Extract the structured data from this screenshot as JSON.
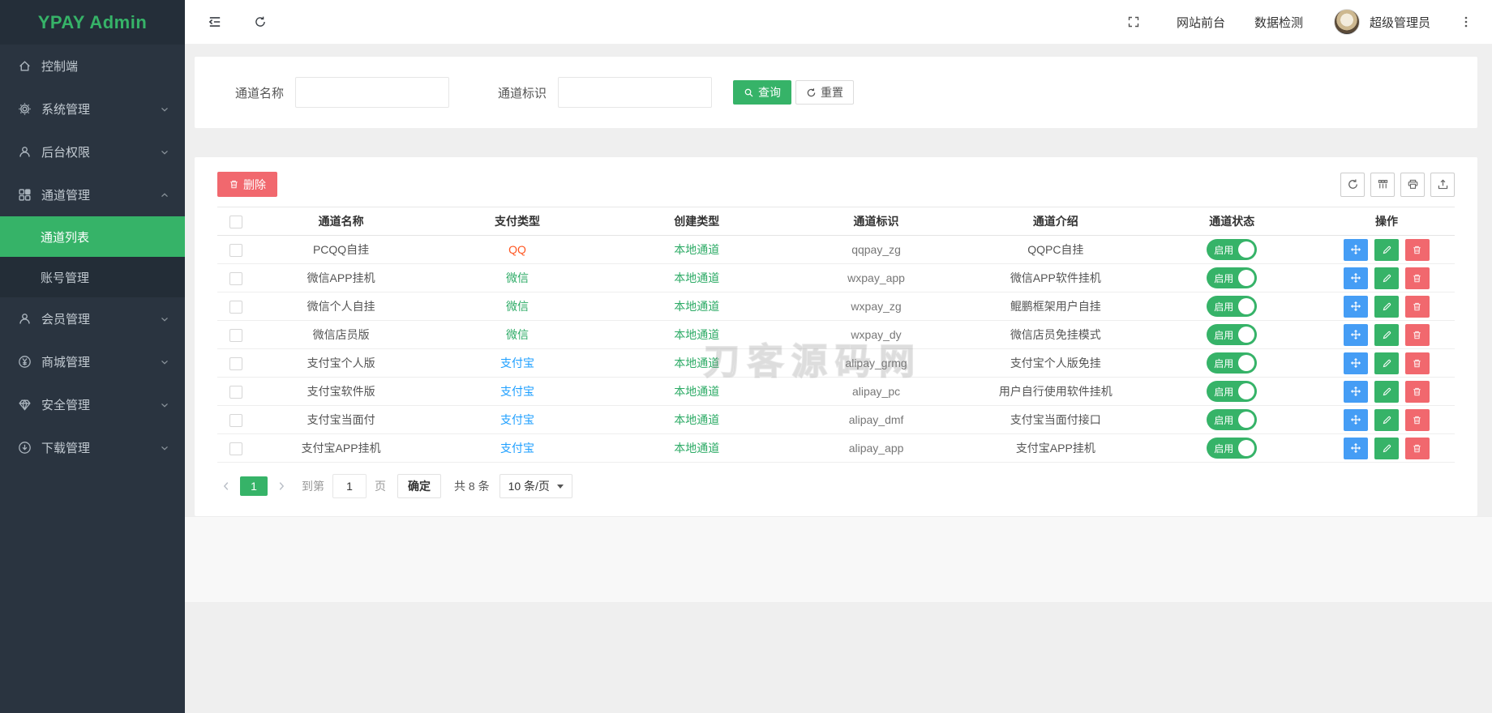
{
  "app": {
    "title": "YPAY Admin"
  },
  "colors": {
    "green": "#36b368",
    "blue": "#459df5",
    "red": "#f1686e",
    "qq_red": "#ff5722",
    "link_blue": "#1e9fff",
    "text_green": "#2dab66",
    "sidebar_bg": "#2a3440"
  },
  "sidebar": {
    "logo": "YPAY Admin",
    "items": [
      {
        "label": "控制端",
        "icon": "home-icon"
      },
      {
        "label": "系统管理",
        "icon": "gear-icon"
      },
      {
        "label": "后台权限",
        "icon": "user-icon"
      },
      {
        "label": "通道管理",
        "icon": "blocks-icon",
        "expanded": true,
        "children": [
          {
            "label": "通道列表",
            "active": true
          },
          {
            "label": "账号管理",
            "active": false
          }
        ]
      },
      {
        "label": "会员管理",
        "icon": "user-icon"
      },
      {
        "label": "商城管理",
        "icon": "yen-circle-icon"
      },
      {
        "label": "安全管理",
        "icon": "gem-icon"
      },
      {
        "label": "下载管理",
        "icon": "download-circle-icon"
      }
    ]
  },
  "topbar": {
    "links": [
      "网站前台",
      "数据检测"
    ],
    "username": "超级管理员",
    "icons": [
      "menu-fold-icon",
      "refresh-icon",
      "fullscreen-icon",
      "more-vertical-icon"
    ]
  },
  "filter": {
    "fields": [
      {
        "label": "通道名称",
        "value": ""
      },
      {
        "label": "通道标识",
        "value": ""
      }
    ],
    "search_label": "查询",
    "reset_label": "重置"
  },
  "table": {
    "delete_label": "删除",
    "toolbar_icons": [
      "refresh-icon",
      "columns-icon",
      "print-icon",
      "export-icon"
    ],
    "columns": [
      "通道名称",
      "支付类型",
      "创建类型",
      "通道标识",
      "通道介绍",
      "通道状态",
      "操作"
    ],
    "rows": [
      {
        "name": "PCQQ自挂",
        "pay_type": "QQ",
        "pay_type_color": "#ff5722",
        "create_type": "本地通道",
        "create_type_color": "#2dab66",
        "code": "qqpay_zg",
        "desc": "QQPC自挂",
        "status": "启用"
      },
      {
        "name": "微信APP挂机",
        "pay_type": "微信",
        "pay_type_color": "#2dab66",
        "create_type": "本地通道",
        "create_type_color": "#2dab66",
        "code": "wxpay_app",
        "desc": "微信APP软件挂机",
        "status": "启用"
      },
      {
        "name": "微信个人自挂",
        "pay_type": "微信",
        "pay_type_color": "#2dab66",
        "create_type": "本地通道",
        "create_type_color": "#2dab66",
        "code": "wxpay_zg",
        "desc": "鲲鹏框架用户自挂",
        "status": "启用"
      },
      {
        "name": "微信店员版",
        "pay_type": "微信",
        "pay_type_color": "#2dab66",
        "create_type": "本地通道",
        "create_type_color": "#2dab66",
        "code": "wxpay_dy",
        "desc": "微信店员免挂模式",
        "status": "启用"
      },
      {
        "name": "支付宝个人版",
        "pay_type": "支付宝",
        "pay_type_color": "#1e9fff",
        "create_type": "本地通道",
        "create_type_color": "#2dab66",
        "code": "alipay_grmg",
        "desc": "支付宝个人版免挂",
        "status": "启用"
      },
      {
        "name": "支付宝软件版",
        "pay_type": "支付宝",
        "pay_type_color": "#1e9fff",
        "create_type": "本地通道",
        "create_type_color": "#2dab66",
        "code": "alipay_pc",
        "desc": "用户自行使用软件挂机",
        "status": "启用"
      },
      {
        "name": "支付宝当面付",
        "pay_type": "支付宝",
        "pay_type_color": "#1e9fff",
        "create_type": "本地通道",
        "create_type_color": "#2dab66",
        "code": "alipay_dmf",
        "desc": "支付宝当面付接口",
        "status": "启用"
      },
      {
        "name": "支付宝APP挂机",
        "pay_type": "支付宝",
        "pay_type_color": "#1e9fff",
        "create_type": "本地通道",
        "create_type_color": "#2dab66",
        "code": "alipay_app",
        "desc": "支付宝APP挂机",
        "status": "启用"
      }
    ]
  },
  "pagination": {
    "current_page": "1",
    "goto_label": "到第",
    "page_value": "1",
    "page_unit": "页",
    "confirm_label": "确定",
    "total_label": "共 8 条",
    "page_size": "10 条/页"
  },
  "watermark": "刀客源码网"
}
